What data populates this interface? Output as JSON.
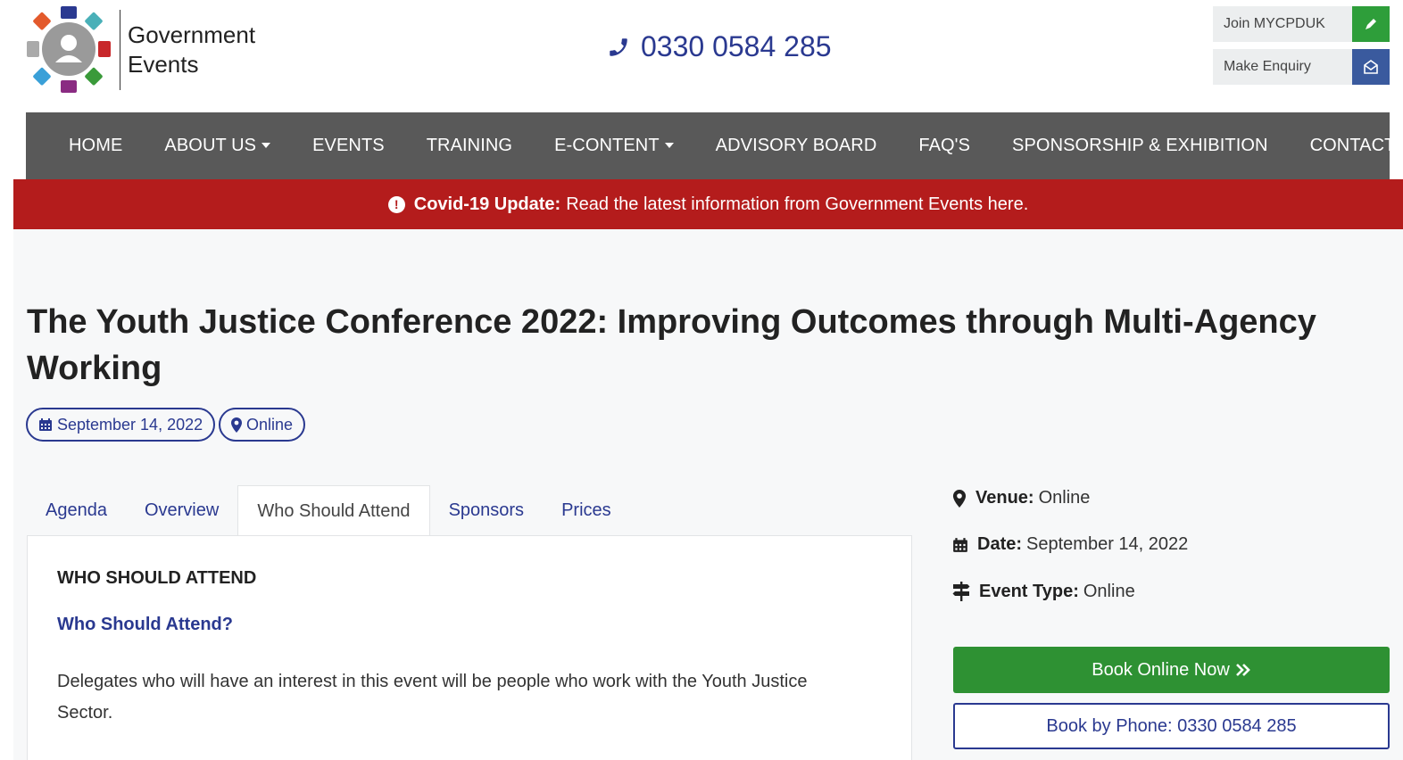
{
  "logo": {
    "line1": "Government",
    "line2": "Events"
  },
  "header": {
    "phone": "0330 0584 285",
    "join_label": "Join MYCPDUK",
    "enquiry_label": "Make Enquiry"
  },
  "nav": {
    "items": [
      {
        "label": "HOME"
      },
      {
        "label": "ABOUT US"
      },
      {
        "label": "EVENTS"
      },
      {
        "label": "TRAINING"
      },
      {
        "label": "E-CONTENT"
      },
      {
        "label": "ADVISORY BOARD"
      },
      {
        "label": "FAQ'S"
      },
      {
        "label": "SPONSORSHIP & EXHIBITION"
      },
      {
        "label": "CONTACT US"
      }
    ]
  },
  "covid": {
    "bold": "Covid-19 Update:",
    "text": "Read the latest information from Government Events here."
  },
  "event": {
    "title": "The Youth Justice Conference 2022: Improving Outcomes through Multi-Agency Working",
    "date": "September 14, 2022",
    "location": "Online"
  },
  "tabs": [
    {
      "label": "Agenda"
    },
    {
      "label": "Overview"
    },
    {
      "label": "Who Should Attend"
    },
    {
      "label": "Sponsors"
    },
    {
      "label": "Prices"
    }
  ],
  "panel": {
    "heading": "WHO SHOULD ATTEND",
    "subheading": "Who Should Attend?",
    "body": "Delegates who will have an interest in this event will be people who work with the Youth Justice Sector."
  },
  "sidebar": {
    "venue_label": "Venue:",
    "venue_value": "Online",
    "date_label": "Date:",
    "date_value": "September 14, 2022",
    "type_label": "Event Type:",
    "type_value": "Online",
    "book_online": "Book Online Now",
    "book_phone": "Book by Phone: 0330 0584 285"
  },
  "colors": {
    "brand_blue": "#2a3990",
    "nav_bg": "#595959",
    "alert_red": "#b41c1c",
    "green": "#2e9133"
  }
}
